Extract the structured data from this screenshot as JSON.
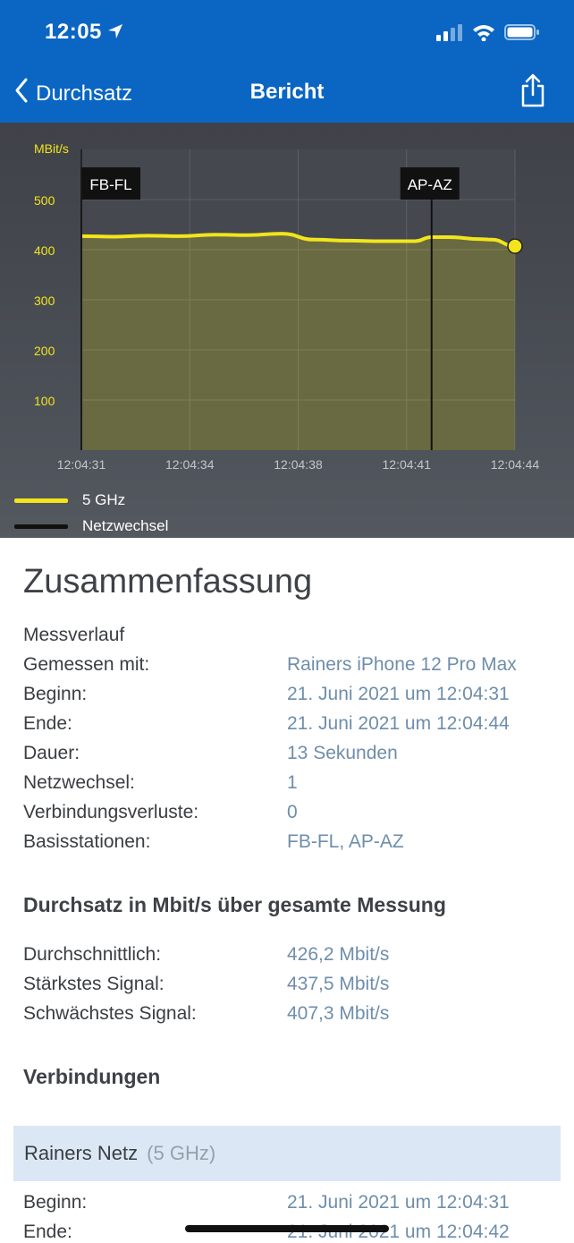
{
  "status_bar": {
    "time": "12:05"
  },
  "nav": {
    "back_label": "Durchsatz",
    "title": "Bericht"
  },
  "chart_data": {
    "type": "line",
    "ylabel": "MBit/s",
    "ylim": [
      0,
      600
    ],
    "yticks": [
      100,
      200,
      300,
      400,
      500
    ],
    "xticks": [
      "12:04:31",
      "12:04:34",
      "12:04:38",
      "12:04:41",
      "12:04:44"
    ],
    "series": [
      {
        "name": "5 GHz",
        "color": "#f2e51c",
        "x": [
          0,
          1,
          2,
          3,
          4,
          5,
          6,
          7,
          8,
          9,
          10,
          10.5,
          11,
          12,
          12.3,
          13
        ],
        "y": [
          427,
          426,
          428,
          427,
          430,
          429,
          432,
          420,
          418,
          417,
          417,
          425,
          425,
          421,
          420,
          407
        ]
      }
    ],
    "events": [
      {
        "label": "FB-FL",
        "x": 0
      },
      {
        "label": "AP-AZ",
        "x": 10.5
      }
    ],
    "legend": [
      {
        "name": "5 GHz",
        "color": "#f2e51c"
      },
      {
        "name": "Netzwechsel",
        "color": "#111111"
      }
    ]
  },
  "summary": {
    "title": "Zusammenfassung",
    "section_messverlauf": "Messverlauf",
    "rows": [
      {
        "label": "Gemessen mit:",
        "value": "Rainers iPhone 12 Pro Max"
      },
      {
        "label": "Beginn:",
        "value": "21. Juni 2021 um 12:04:31"
      },
      {
        "label": "Ende:",
        "value": "21. Juni 2021 um 12:04:44"
      },
      {
        "label": "Dauer:",
        "value": "13 Sekunden"
      },
      {
        "label": "Netzwechsel:",
        "value": "1"
      },
      {
        "label": "Verbindungsverluste:",
        "value": "0"
      },
      {
        "label": "Basisstationen:",
        "value": "FB-FL, AP-AZ"
      }
    ],
    "throughput_heading": "Durchsatz in Mbit/s über gesamte Messung",
    "throughput_rows": [
      {
        "label": "Durchschnittlich:",
        "value": "426,2 Mbit/s"
      },
      {
        "label": "Stärkstes Signal:",
        "value": "437,5 Mbit/s"
      },
      {
        "label": "Schwächstes Signal:",
        "value": "407,3 Mbit/s"
      }
    ],
    "connections_heading": "Verbindungen",
    "connection": {
      "name": "Rainers Netz",
      "band": "(5 GHz)",
      "rows": [
        {
          "label": "Beginn:",
          "value": "21. Juni 2021 um 12:04:31"
        },
        {
          "label": "Ende:",
          "value": "21. Juni 2021 um 12:04:42"
        }
      ]
    }
  }
}
